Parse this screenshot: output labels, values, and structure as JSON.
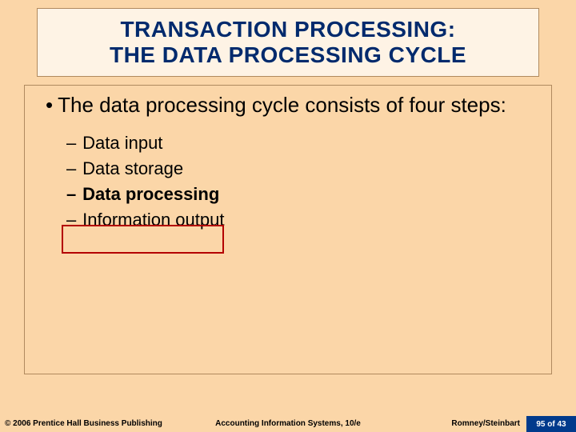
{
  "title": {
    "line1": "TRANSACTION PROCESSING:",
    "line2": "THE DATA PROCESSING CYCLE"
  },
  "lead": "The data processing cycle consists of four steps:",
  "items": [
    {
      "text": "Data input",
      "bold": false,
      "boxed": false
    },
    {
      "text": "Data storage",
      "bold": false,
      "boxed": false
    },
    {
      "text": "Data processing",
      "bold": true,
      "boxed": true
    },
    {
      "text": "Information output",
      "bold": false,
      "boxed": false
    }
  ],
  "footer": {
    "copyright": "© 2006 Prentice Hall Business Publishing",
    "center": "Accounting Information Systems, 10/e",
    "authors": "Romney/Steinbart",
    "page_current": "95",
    "page_total": "43"
  }
}
